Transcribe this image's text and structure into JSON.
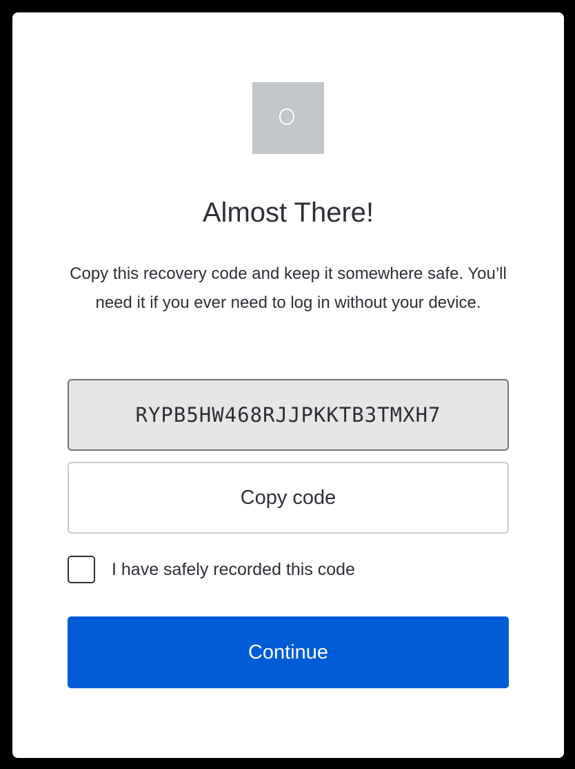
{
  "dialog": {
    "logo_icon": "circle-logo-placeholder-icon",
    "title": "Almost There!",
    "description": "Copy this recovery code and keep it somewhere safe. You’ll need it if you ever need to log in without your device.",
    "recovery_code": "RYPB5HW468RJJPKKTB3TMXH7",
    "copy_button_label": "Copy code",
    "confirm_checkbox_label": "I have safely recorded this code",
    "confirm_checked": false,
    "continue_button_label": "Continue"
  },
  "colors": {
    "primary": "#005cd6",
    "code_background": "#e6e6e6",
    "logo_background": "#c2c6ca",
    "text": "#2b2f36"
  }
}
